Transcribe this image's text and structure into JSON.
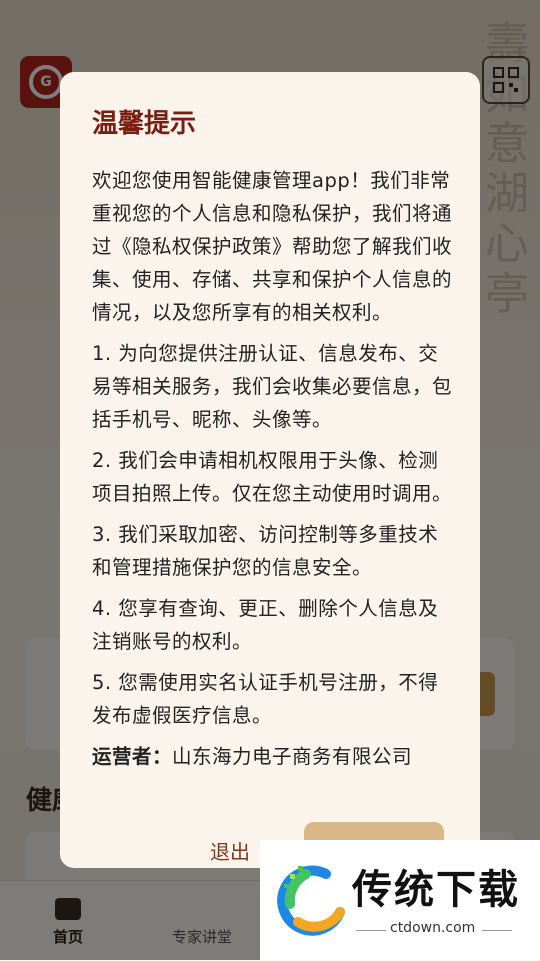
{
  "background_app": {
    "nav": {
      "home_label": "首页",
      "lecture_label": "专家讲堂"
    },
    "section_title": "健康"
  },
  "dialog": {
    "title": "温馨提示",
    "intro": "欢迎您使用智能健康管理app！我们非常重视您的个人信息和隐私保护，我们将通过《隐私权保护政策》帮助您了解我们收集、使用、存储、共享和保护个人信息的情况，以及您所享有的相关权利。",
    "items": [
      "1. 为向您提供注册认证、信息发布、交易等相关服务，我们会收集必要信息，包括手机号、昵称、头像等。",
      "2. 我们会申请相机权限用于头像、检测项目拍照上传。仅在您主动使用时调用。",
      "3. 我们采取加密、访问控制等多重技术和管理措施保护您的信息安全。",
      "4. 您享有查询、更正、删除个人信息及注销账号的权利。",
      "5. 您需使用实名认证手机号注册，不得发布虚假医疗信息。"
    ],
    "operator_label": "运营者：",
    "operator_value": "山东海力电子商务有限公司",
    "exit_label": "退出",
    "agree_label": ""
  },
  "watermark": {
    "brand": "传统下载",
    "domain": "ctdown.com"
  },
  "colors": {
    "title": "#7b1e12",
    "agree_button": "#d9b786",
    "exit_text": "#7b3a18"
  }
}
